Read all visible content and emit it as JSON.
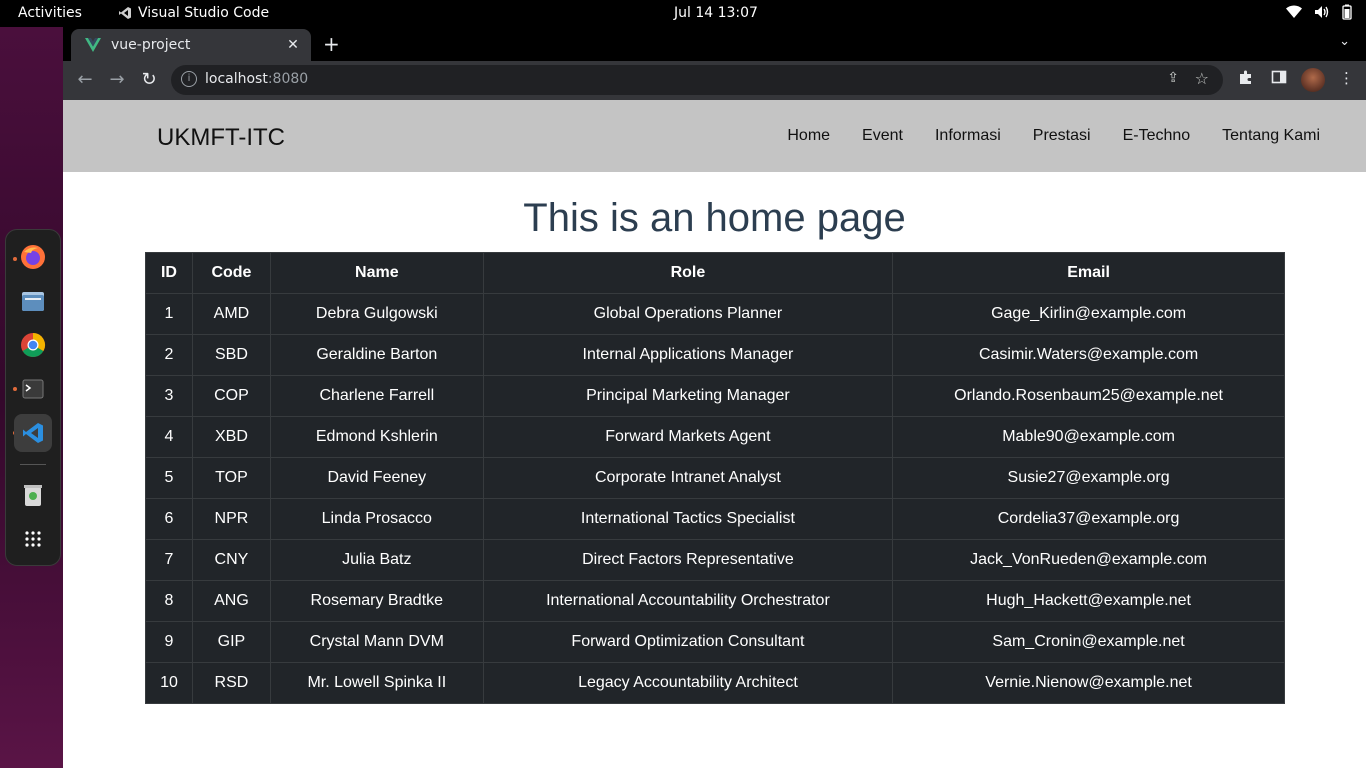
{
  "system": {
    "activities": "Activities",
    "app_name": "Visual Studio Code",
    "clock": "Jul 14  13:07"
  },
  "browser": {
    "tab_title": "vue-project",
    "url_host": "localhost",
    "url_port": ":8080"
  },
  "site": {
    "brand": "UKMFT-ITC",
    "nav": [
      "Home",
      "Event",
      "Informasi",
      "Prestasi",
      "E-Techno",
      "Tentang Kami"
    ],
    "heading": "This is an home page"
  },
  "table": {
    "headers": [
      "ID",
      "Code",
      "Name",
      "Role",
      "Email"
    ],
    "rows": [
      [
        "1",
        "AMD",
        "Debra Gulgowski",
        "Global Operations Planner",
        "Gage_Kirlin@example.com"
      ],
      [
        "2",
        "SBD",
        "Geraldine Barton",
        "Internal Applications Manager",
        "Casimir.Waters@example.com"
      ],
      [
        "3",
        "COP",
        "Charlene Farrell",
        "Principal Marketing Manager",
        "Orlando.Rosenbaum25@example.net"
      ],
      [
        "4",
        "XBD",
        "Edmond Kshlerin",
        "Forward Markets Agent",
        "Mable90@example.com"
      ],
      [
        "5",
        "TOP",
        "David Feeney",
        "Corporate Intranet Analyst",
        "Susie27@example.org"
      ],
      [
        "6",
        "NPR",
        "Linda Prosacco",
        "International Tactics Specialist",
        "Cordelia37@example.org"
      ],
      [
        "7",
        "CNY",
        "Julia Batz",
        "Direct Factors Representative",
        "Jack_VonRueden@example.com"
      ],
      [
        "8",
        "ANG",
        "Rosemary Bradtke",
        "International Accountability Orchestrator",
        "Hugh_Hackett@example.net"
      ],
      [
        "9",
        "GIP",
        "Crystal Mann DVM",
        "Forward Optimization Consultant",
        "Sam_Cronin@example.net"
      ],
      [
        "10",
        "RSD",
        "Mr. Lowell Spinka II",
        "Legacy Accountability Architect",
        "Vernie.Nienow@example.net"
      ]
    ]
  },
  "colors": {
    "navbar_bg": "#c4c4c4",
    "heading": "#2c3e50",
    "table_bg": "#212529",
    "vue_green": "#41b883"
  },
  "icons": {
    "dock": [
      "firefox-icon",
      "files-icon",
      "chrome-icon",
      "terminal-icon",
      "vscode-icon",
      "trash-icon",
      "app-grid-icon"
    ]
  }
}
